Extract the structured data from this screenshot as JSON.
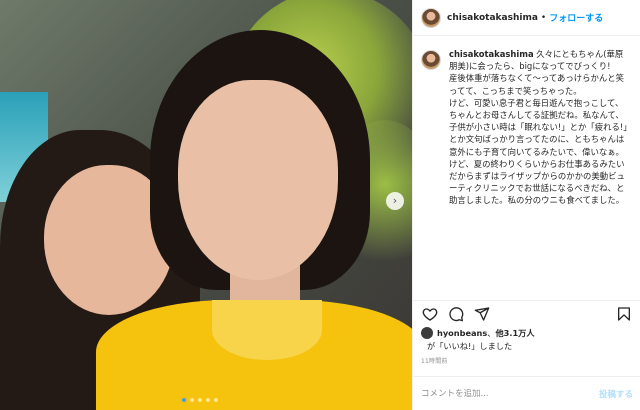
{
  "header": {
    "username": "chisakotakashima",
    "separator": "•",
    "follow_label": "フォローする"
  },
  "caption": {
    "username": "chisakotakashima",
    "lines": [
      "久々にともちゃん(華原朋美)に会ったら、bigになってでびっくり!",
      "産後体重が落ちなくて〜ってあっけらかんと笑ってて、こっちまで笑っちゃった。",
      "けど、可愛い息子君と毎日遊んで抱っこして、ちゃんとお母さんしてる証拠だね。私なんて、子供が小さい時は「眠れない!」とか「疲れる!」とか文句ばっかり言ってたのに、ともちゃんは意外にも子育て向いてるみたいで、偉いなぁ。",
      "けど、夏の終わりくらいからお仕事あるみたいだからまずはライザップからのかかの美動ビューティクリニックでお世話になるべきだね、と助言しました。私の分のウニも食べてました。"
    ]
  },
  "likes": {
    "liker": "hyonbeans",
    "others": "他3.1万人",
    "line2": "が「いいね!」しました"
  },
  "time": "11時間前",
  "comment": {
    "placeholder": "コメントを追加...",
    "post_label": "投稿する"
  },
  "carousel": {
    "slide_count": 5,
    "active_index": 0
  },
  "colors": {
    "accent": "#0095f6",
    "post_disabled": "#b2dffc",
    "muted": "#8e8e8e"
  },
  "icons": {
    "like": "heart-icon",
    "comment": "comment-icon",
    "share": "paper-plane-icon",
    "save": "bookmark-icon",
    "next": "chevron-right-icon"
  }
}
